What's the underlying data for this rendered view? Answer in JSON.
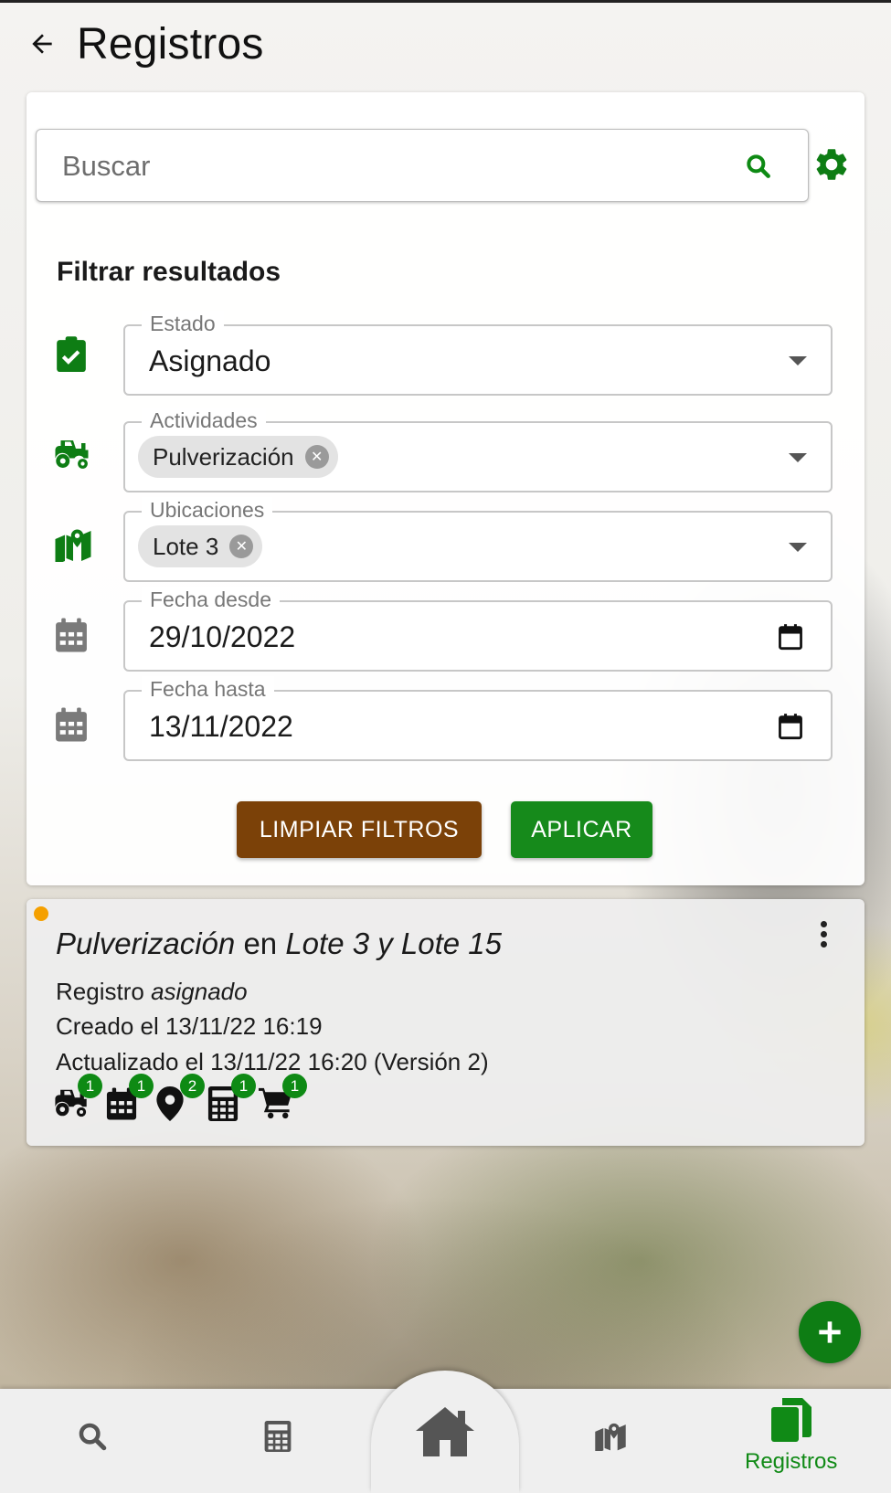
{
  "header": {
    "title": "Registros",
    "back_icon": "arrow-left-icon"
  },
  "search": {
    "placeholder": "Buscar"
  },
  "filters": {
    "title": "Filtrar resultados",
    "estado": {
      "label": "Estado",
      "value": "Asignado"
    },
    "actividades": {
      "label": "Actividades",
      "chip": "Pulverización"
    },
    "ubicaciones": {
      "label": "Ubicaciones",
      "chip": "Lote 3"
    },
    "fecha_desde": {
      "label": "Fecha desde",
      "value": "29/10/2022"
    },
    "fecha_hasta": {
      "label": "Fecha hasta",
      "value": "13/11/2022"
    },
    "clear_label": "LIMPIAR FILTROS",
    "apply_label": "APLICAR"
  },
  "record": {
    "title_activity": "Pulverización",
    "title_en": "en",
    "title_locations": "Lote 3 y Lote 15",
    "status_prefix": "Registro",
    "status_value": "asignado",
    "created": "Creado el 13/11/22 16:19",
    "updated": "Actualizado el 13/11/22 16:20 (Versión 2)",
    "badges": [
      {
        "icon": "tractor-icon",
        "count": "1"
      },
      {
        "icon": "calendar-icon",
        "count": "1"
      },
      {
        "icon": "location-pin-icon",
        "count": "2"
      },
      {
        "icon": "calculator-icon",
        "count": "1"
      },
      {
        "icon": "cart-icon",
        "count": "1"
      }
    ]
  },
  "bottom_nav": {
    "items": [
      "search",
      "calculator",
      "home",
      "map",
      "registros"
    ],
    "active_label": "Registros"
  },
  "colors": {
    "primary_green": "#168a1b",
    "brown": "#7b4108",
    "status_orange": "#f5a000"
  }
}
